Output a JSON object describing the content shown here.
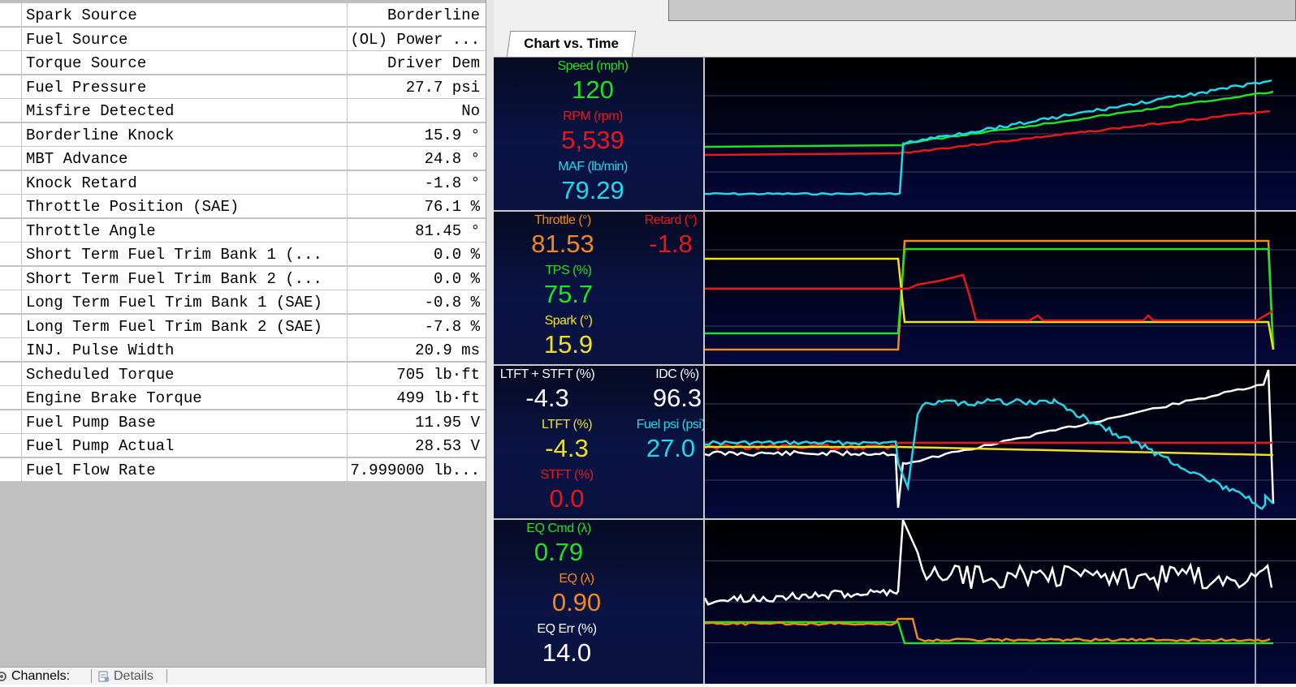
{
  "params": [
    {
      "name": "Spark Source",
      "value": "Borderline"
    },
    {
      "name": "Fuel Source",
      "value": "(OL) Power ..."
    },
    {
      "name": "Torque Source",
      "value": "Driver Dem"
    },
    {
      "name": "Fuel Pressure",
      "value": "27.7 psi"
    },
    {
      "name": "Misfire Detected",
      "value": "No"
    },
    {
      "name": "Borderline Knock",
      "value": "15.9 °"
    },
    {
      "name": "MBT Advance",
      "value": "24.8 °"
    },
    {
      "name": "Knock Retard",
      "value": "-1.8 °"
    },
    {
      "name": "Throttle Position (SAE)",
      "value": "76.1 %"
    },
    {
      "name": "Throttle Angle",
      "value": "81.45 °"
    },
    {
      "name": "Short Term Fuel Trim Bank 1 (...",
      "value": "0.0 %"
    },
    {
      "name": "Short Term Fuel Trim Bank 2 (...",
      "value": "0.0 %"
    },
    {
      "name": "Long Term Fuel Trim Bank 1 (SAE)",
      "value": "-0.8 %"
    },
    {
      "name": "Long Term Fuel Trim Bank 2 (SAE)",
      "value": "-7.8 %"
    },
    {
      "name": "INJ. Pulse Width",
      "value": "20.9 ms"
    },
    {
      "name": "Scheduled Torque",
      "value": "705 lb·ft"
    },
    {
      "name": "Engine Brake Torque",
      "value": "499 lb·ft"
    },
    {
      "name": "Fuel Pump Base",
      "value": "11.95 V"
    },
    {
      "name": "Fuel Pump Actual",
      "value": "28.53 V"
    },
    {
      "name": "Fuel Flow Rate",
      "value": "7.999000 lb..."
    }
  ],
  "bottom_tabs": {
    "channels": "Channels:",
    "details": "Details"
  },
  "chart_tab": "Chart vs. Time",
  "panels": [
    {
      "readouts": [
        {
          "label": "Speed (mph)",
          "value": "120",
          "color": "#22e022"
        },
        {
          "label": "RPM (rpm)",
          "value": "5,539",
          "color": "#e81818"
        },
        {
          "label": "MAF (lb/min)",
          "value": "79.29",
          "color": "#22d8e8"
        }
      ]
    },
    {
      "readouts": [
        {
          "label": "Throttle (°)",
          "value": "81.53",
          "color": "#f08a1c"
        },
        {
          "label": "Retard (°)",
          "value": "-1.8",
          "color": "#e81818"
        },
        {
          "label": "TPS (%)",
          "value": "75.7",
          "color": "#22e022"
        },
        {
          "label": "Spark (°)",
          "value": "15.9",
          "color": "#f0e020"
        }
      ]
    },
    {
      "readouts": [
        {
          "label": "LTFT + STFT (%)",
          "value": "-4.3",
          "color": "#ffffff"
        },
        {
          "label": "IDC (%)",
          "value": "96.3",
          "color": "#ffffff"
        },
        {
          "label": "LTFT (%)",
          "value": "-4.3",
          "color": "#f0e020"
        },
        {
          "label": "Fuel psi (psi)",
          "value": "27.0",
          "color": "#22d8e8"
        },
        {
          "label": "STFT (%)",
          "value": "0.0",
          "color": "#e81818"
        }
      ]
    },
    {
      "readouts": [
        {
          "label": "EQ Cmd (λ)",
          "value": "0.79",
          "color": "#22e022"
        },
        {
          "label": "EQ (λ)",
          "value": "0.90",
          "color": "#f08a1c"
        },
        {
          "label": "EQ Err (%)",
          "value": "14.0",
          "color": "#ffffff"
        }
      ]
    }
  ]
}
